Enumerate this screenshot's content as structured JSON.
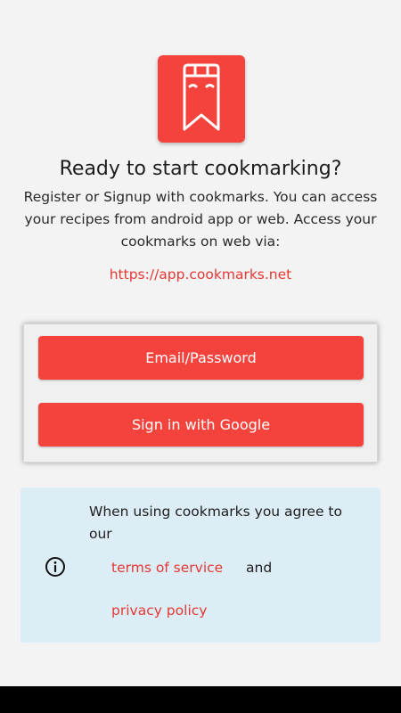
{
  "app": {
    "logo_icon": "bookmark-chef-icon",
    "brand_color": "#f4433c",
    "link_color": "#e53935"
  },
  "intro": {
    "title": "Ready to start cookmarking?",
    "description": "Register or Signup with cookmarks. You can access your recipes from android app or web. Access your cookmarks on web via:",
    "web_link": "https://app.cookmarks.net"
  },
  "auth": {
    "email_button": "Email/Password",
    "google_button": "Sign in with Google"
  },
  "terms": {
    "icon": "info-icon",
    "agree_text": "When using cookmarks you agree to our",
    "terms_link": "terms of service",
    "and_text": "and",
    "privacy_link": "privacy policy",
    "background": "#dcedf6"
  }
}
